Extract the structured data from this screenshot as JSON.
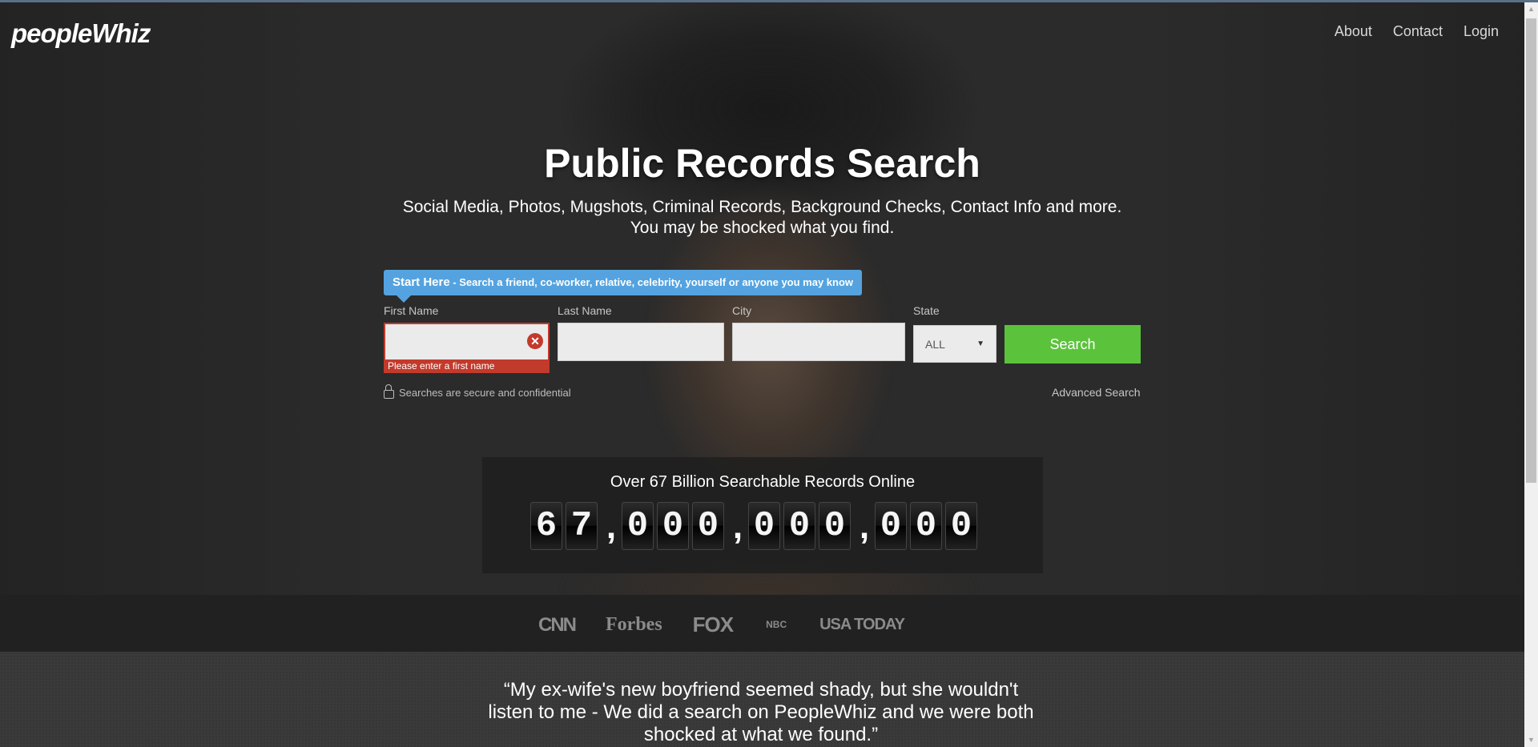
{
  "brand": {
    "logo_text": "peopleWhiz"
  },
  "nav": {
    "about": "About",
    "contact": "Contact",
    "login": "Login"
  },
  "hero": {
    "title": "Public Records Search",
    "subtitle_line1": "Social Media, Photos, Mugshots, Criminal Records, Background Checks, Contact Info and more.",
    "subtitle_line2": "You may be shocked what you find."
  },
  "search": {
    "tip_strong": "Start Here",
    "tip_text": " - Search a friend, co-worker, relative, celebrity, yourself or anyone you may know",
    "first_name_label": "First Name",
    "last_name_label": "Last Name",
    "city_label": "City",
    "state_label": "State",
    "first_name_value": "",
    "last_name_value": "",
    "city_value": "",
    "state_selected": "ALL",
    "error_message": "Please enter a first name",
    "clear_symbol": "✕",
    "button_label": "Search",
    "secure_text": "Searches are secure and confidential",
    "advanced_label": "Advanced Search"
  },
  "counter": {
    "title": "Over 67 Billion Searchable Records Online",
    "groups": [
      "67",
      "000",
      "000",
      "000"
    ],
    "separator": ","
  },
  "press": {
    "cnn": "CNN",
    "forbes": "Forbes",
    "fox": "FOX",
    "nbc": "NBC",
    "usa_today": "USA TODAY"
  },
  "testimonial": {
    "quote": "“My ex-wife's new boyfriend seemed shady, but she wouldn't listen to me - We did a search on PeopleWhiz and we were both shocked at what we found.”"
  },
  "colors": {
    "accent_blue": "#54a3e0",
    "search_green": "#5bc33b",
    "error_red": "#c23a2b"
  },
  "icons": [
    "clear-icon",
    "lock-icon",
    "chevron-down-icon",
    "scroll-up-icon",
    "scroll-down-icon"
  ]
}
